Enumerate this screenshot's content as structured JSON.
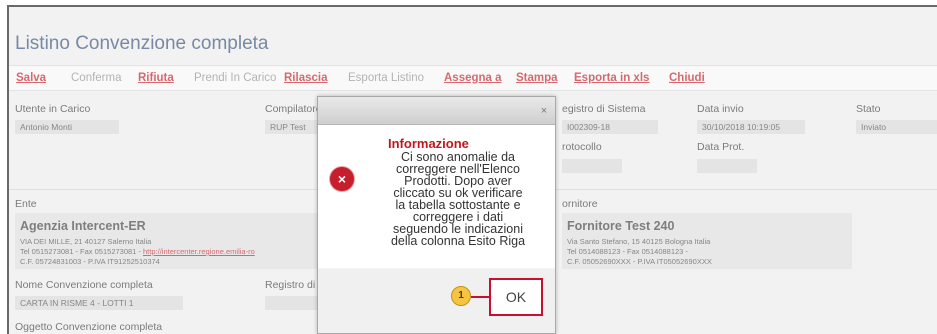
{
  "page": {
    "title": "Listino Convenzione completa"
  },
  "toolbar": {
    "salva": "Salva",
    "conferma": "Conferma",
    "rifiuta": "Rifiuta",
    "prendi_in_carico": "Prendi In Carico",
    "rilascia": "Rilascia",
    "esporta_listino": "Esporta Listino",
    "assegna_a": "Assegna a",
    "stampa": "Stampa",
    "esporta_in_xls": "Esporta in xls",
    "chiudi": "Chiudi"
  },
  "fields": {
    "utente_in_carico_label": "Utente in Carico",
    "utente_in_carico_value": "Antonio Monti",
    "compilatore_label": "Compilatore",
    "compilatore_value": "RUP Test",
    "registro_label": "egistro di Sistema",
    "registro_value": "I002309-18",
    "data_invio_label": "Data invio",
    "data_invio_value": "30/10/2018 10:19:05",
    "stato_label": "Stato",
    "stato_value": "Inviato",
    "protocollo_label": "rotocollo",
    "data_prot_label": "Data Prot.",
    "ente_label": "Ente",
    "fornitore_label": "ornitore",
    "nome_conv_label": "Nome Convenzione completa",
    "nome_conv_value": "CARTA IN RISME 4 - LOTTI 1",
    "registro_s_label": "Registro di S",
    "oggetto_label": "Oggetto Convenzione completa"
  },
  "ente": {
    "name": "Agenzia Intercent-ER",
    "address": "VIA DEI MILLE, 21 40127 Salerno Italia",
    "contacts": "Tel 0515273081 - Fax 0515273081 - ",
    "link": "http://intercenter.regione.emilia-ro",
    "fiscal": "C.F. 05724831003 - P.IVA IT91252510374"
  },
  "fornitore": {
    "name": "Fornitore Test 240",
    "address": "Via Santo Stefano, 15 40125 Bologna Italia",
    "contacts": "Tel 0514088123 - Fax 0514088123 -",
    "fiscal": "C.F. 05052690XXX - P.IVA IT05052690XXX"
  },
  "dialog": {
    "close_glyph": "×",
    "title": "Informazione",
    "message_lines": [
      "Ci sono anomalie da",
      "correggere nell'Elenco",
      "Prodotti. Dopo aver",
      "cliccato su ok verificare",
      "la tabella sottostante e",
      "correggere i dati",
      "seguendo le indicazioni",
      "della colonna Esito Riga"
    ],
    "error_glyph": "×",
    "ok_label": "OK",
    "marker_number": "1"
  },
  "colors": {
    "accent_red": "#c0181f",
    "title_blue": "#2e4a73",
    "marker_yellow": "#f6c342"
  },
  "icons": [
    "close-icon",
    "error-icon",
    "step-marker"
  ]
}
